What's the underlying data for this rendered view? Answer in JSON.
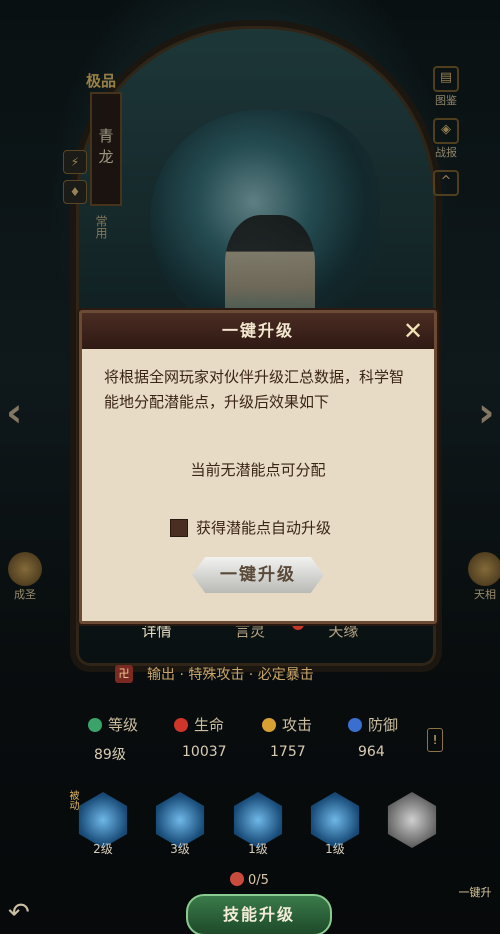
{
  "hero": {
    "grade": "极品",
    "name": "青龙",
    "rank_label": "常用"
  },
  "right_menu": [
    {
      "label": "图鉴",
      "icon": "book-icon"
    },
    {
      "label": "战报",
      "icon": "scroll-icon"
    },
    {
      "label": "",
      "icon": "chevron-up-icon"
    }
  ],
  "side_buttons": {
    "left": "成圣",
    "right": "天相"
  },
  "dialog": {
    "title": "一键升级",
    "body": "将根据全网玩家对伙伴升级汇总数据，科学智能地分配潜能点，升级后效果如下",
    "status": "当前无潜能点可分配",
    "checkbox_label": "获得潜能点自动升级",
    "confirm_label": "一键升级"
  },
  "tabs": [
    {
      "label": "详情",
      "active": true
    },
    {
      "label": "言灵",
      "badge": "!"
    },
    {
      "label": "天缘"
    }
  ],
  "traits": "输出 · 特殊攻击 · 必定暴击",
  "stats": [
    {
      "label": "等级",
      "value": "89级",
      "color": "#3aa36a"
    },
    {
      "label": "生命",
      "value": "10037",
      "color": "#d0352b"
    },
    {
      "label": "攻击",
      "value": "1757",
      "color": "#d8a032"
    },
    {
      "label": "防御",
      "value": "964",
      "color": "#3a6fd0"
    }
  ],
  "passive_tag": "被动",
  "skills": [
    {
      "level": "2级"
    },
    {
      "level": "3级"
    },
    {
      "level": "1级"
    },
    {
      "level": "1级"
    },
    {
      "level": ""
    }
  ],
  "skill_points": "0/5",
  "skill_up_button": "技能升级",
  "onekey_label": "一键升"
}
